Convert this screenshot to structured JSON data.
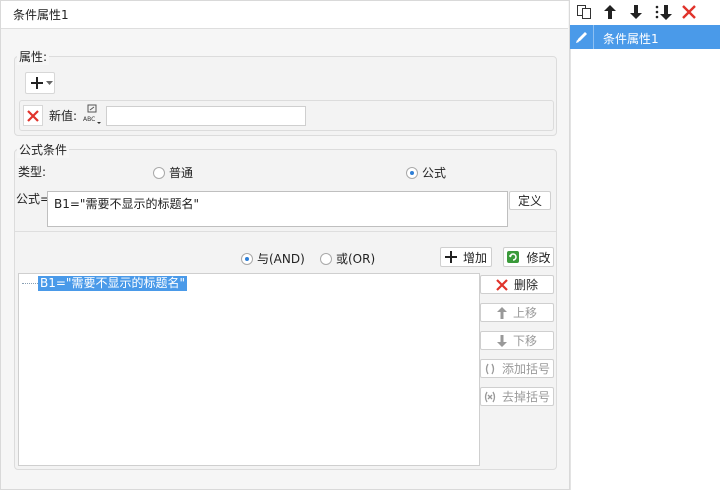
{
  "window": {
    "title": "条件属性1"
  },
  "properties_group": {
    "label": "属性:",
    "new_value_label": "新值:",
    "new_value": "",
    "abc_caption": "ABC"
  },
  "formula_group": {
    "label": "公式条件",
    "type_label": "类型:",
    "type_options": [
      {
        "label": "普通",
        "selected": false
      },
      {
        "label": "公式",
        "selected": true
      }
    ],
    "formula_label": "公式=",
    "formula_value": "B1=\"需要不显示的标题名\"",
    "define_button": "定义",
    "logic_options": [
      {
        "label": "与(AND)",
        "selected": true
      },
      {
        "label": "或(OR)",
        "selected": false
      }
    ],
    "add_button": "增加",
    "modify_button": "修改",
    "conditions": [
      "B1=\"需要不显示的标题名\""
    ],
    "side_buttons": {
      "delete": "删除",
      "move_up": "上移",
      "move_down": "下移",
      "add_parens": "添加括号",
      "remove_parens": "去掉括号"
    }
  },
  "right_panel": {
    "items": [
      {
        "label": "条件属性1",
        "selected": true
      }
    ]
  },
  "colors": {
    "accent": "#4a9ae9",
    "delete_red": "#e0332b",
    "add_green": "#3a9a3a"
  }
}
